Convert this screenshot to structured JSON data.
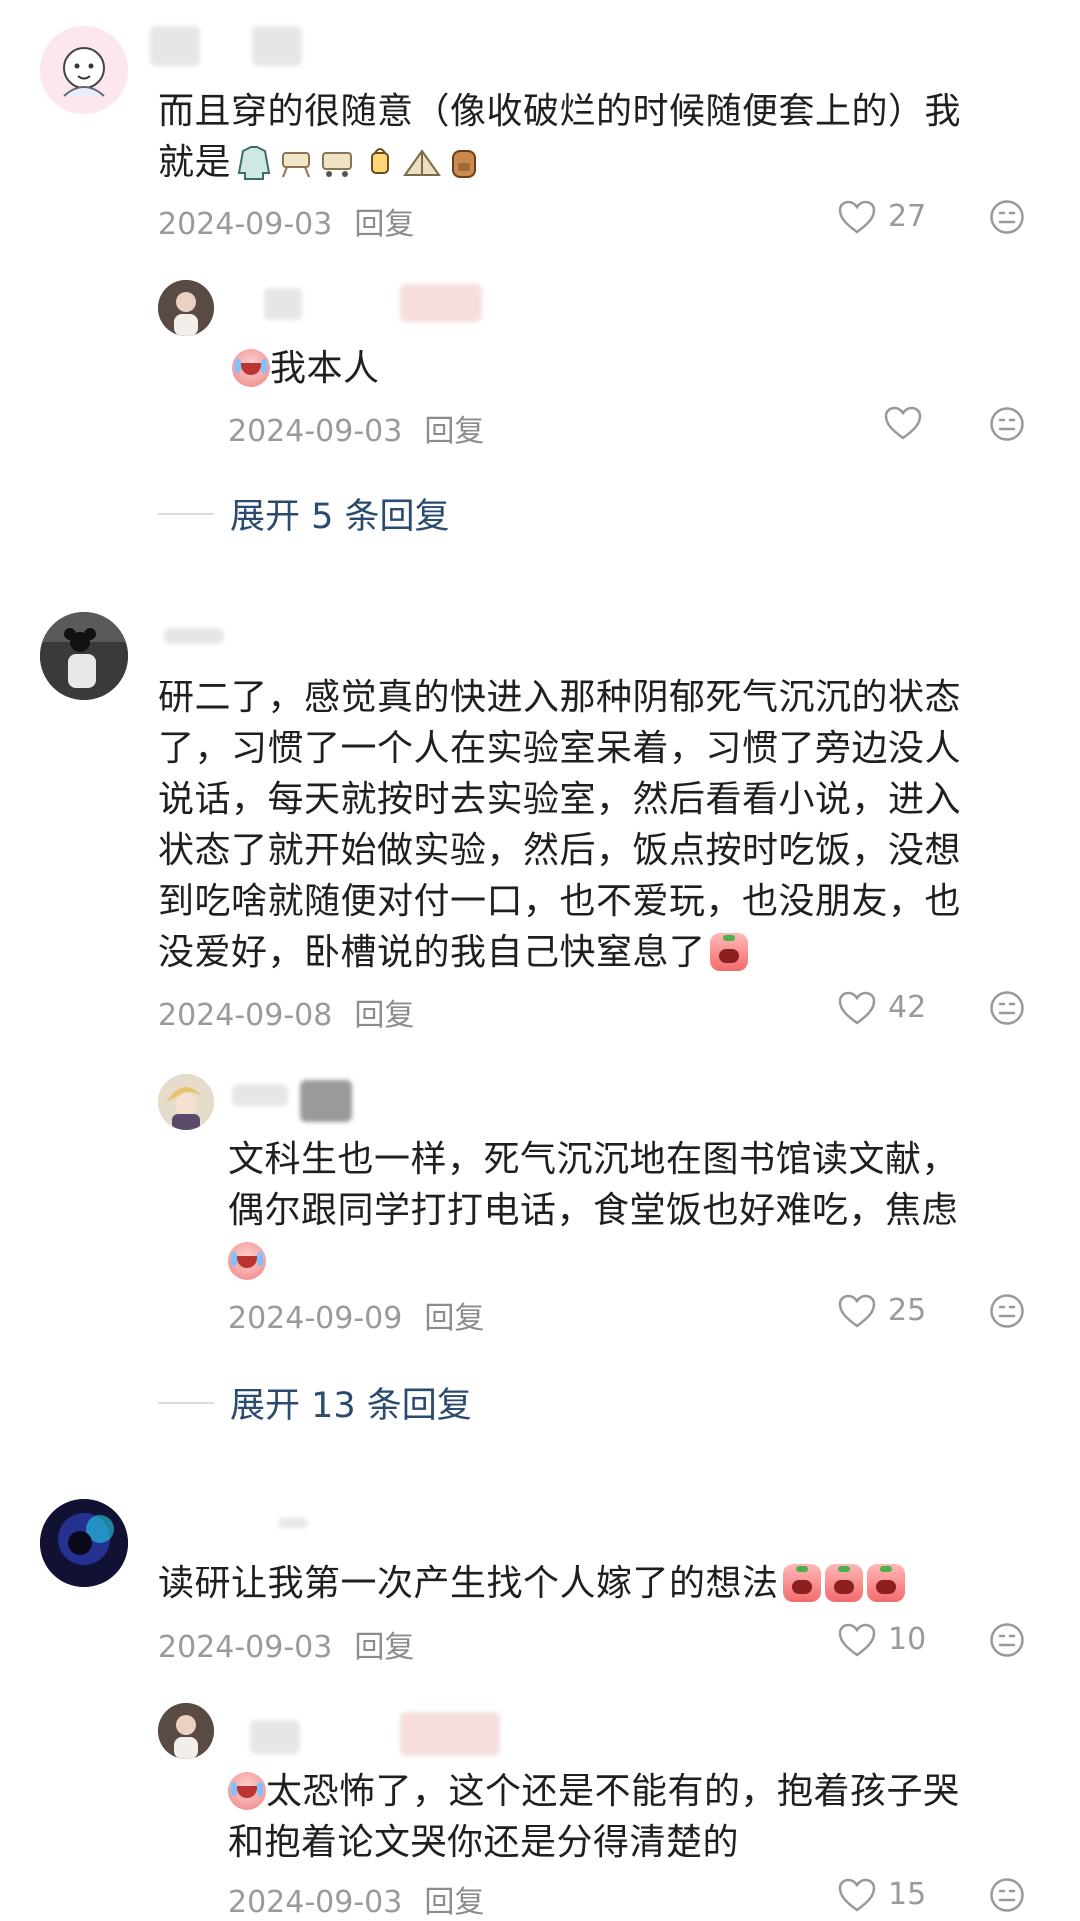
{
  "comments": [
    {
      "text": "而且穿的很随意（像收破烂的时候随便套上的）我",
      "text2": "就是",
      "emojis": [
        "jacket-icon",
        "folding-chair-icon",
        "cart-icon",
        "lantern-icon",
        "tent-icon",
        "backpack-icon"
      ],
      "date": "2024-09-03",
      "reply_label": "回复",
      "likes": "27",
      "replies": [
        {
          "text": "我本人",
          "date": "2024-09-03",
          "reply_label": "回复",
          "likes": ""
        }
      ],
      "expand_label": "展开 5 条回复"
    },
    {
      "lines": [
        "研二了，感觉真的快进入那种阴郁死气沉沉的状态",
        "了，习惯了一个人在实验室呆着，习惯了旁边没人",
        "说话，每天就按时去实验室，然后看看小说，进入",
        "状态了就开始做实验，然后，饭点按时吃饭，没想",
        "到吃啥就随便对付一口，也不爱玩，也没朋友，也",
        "没爱好，卧槽说的我自己快窒息了"
      ],
      "date": "2024-09-08",
      "reply_label": "回复",
      "likes": "42",
      "replies": [
        {
          "lines": [
            "文科生也一样，死气沉沉地在图书馆读文献，",
            "偶尔跟同学打打电话，食堂饭也好难吃，焦虑"
          ],
          "date": "2024-09-09",
          "reply_label": "回复",
          "likes": "25"
        }
      ],
      "expand_label": "展开 13 条回复"
    },
    {
      "text": "读研让我第一次产生找个人嫁了的想法",
      "date": "2024-09-03",
      "reply_label": "回复",
      "likes": "10",
      "replies": [
        {
          "lines": [
            "太恐怖了，这个还是不能有的，抱着孩子哭",
            "和抱着论文哭你还是分得清楚的"
          ],
          "date": "2024-09-03",
          "reply_label": "回复",
          "likes": "15"
        }
      ]
    }
  ]
}
